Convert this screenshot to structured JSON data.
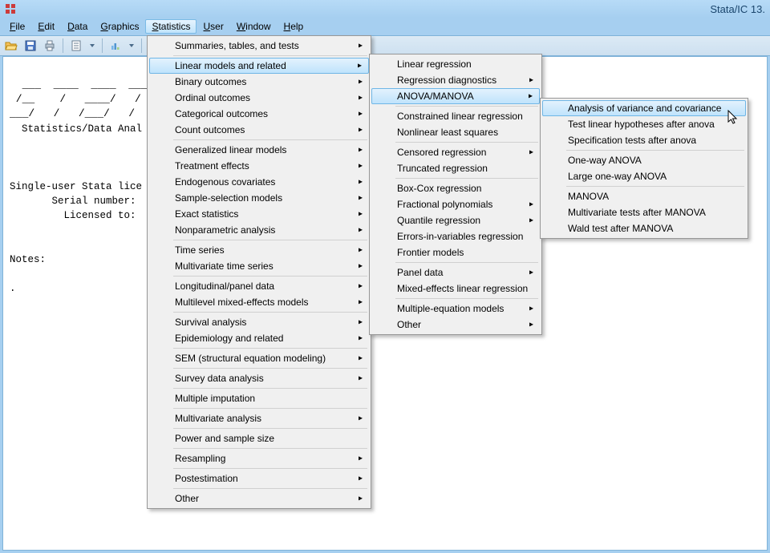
{
  "window": {
    "title": "Stata/IC 13."
  },
  "menubar": {
    "file": "File",
    "edit": "Edit",
    "data": "Data",
    "graphics": "Graphics",
    "statistics": "Statistics",
    "user": "User",
    "window": "Window",
    "help": "Help"
  },
  "ascii": {
    "l1": "  ___  ____  ____  ___",
    "l2": " /__    /   ____/   / ",
    "l3": "___/   /   /___/   / ",
    "l4": "  Statistics/Data Anal"
  },
  "content": {
    "license1": "Single-user Stata lice",
    "license2": "       Serial number:",
    "license3": "         Licensed to:",
    "notes": "Notes:",
    "dot": "."
  },
  "stats_menu": {
    "summaries": "Summaries, tables, and tests",
    "linear": "Linear models and related",
    "binary": "Binary outcomes",
    "ordinal": "Ordinal outcomes",
    "categorical": "Categorical outcomes",
    "count": "Count outcomes",
    "glm": "Generalized linear models",
    "treatment": "Treatment effects",
    "endog": "Endogenous covariates",
    "sample": "Sample-selection models",
    "exact": "Exact statistics",
    "nonparam": "Nonparametric analysis",
    "ts": "Time series",
    "mts": "Multivariate time series",
    "longitudinal": "Longitudinal/panel data",
    "multilevel": "Multilevel mixed-effects models",
    "survival": "Survival analysis",
    "epi": "Epidemiology and related",
    "sem": "SEM (structural equation modeling)",
    "survey": "Survey data analysis",
    "mi": "Multiple imputation",
    "mv": "Multivariate analysis",
    "power": "Power and sample size",
    "resampling": "Resampling",
    "postest": "Postestimation",
    "other": "Other"
  },
  "linear_menu": {
    "linreg": "Linear regression",
    "regdiag": "Regression diagnostics",
    "anova": "ANOVA/MANOVA",
    "cnsreg": "Constrained linear regression",
    "nl": "Nonlinear least squares",
    "censored": "Censored regression",
    "truncated": "Truncated regression",
    "boxcox": "Box-Cox regression",
    "fracpoly": "Fractional polynomials",
    "qreg": "Quantile regression",
    "eivreg": "Errors-in-variables regression",
    "frontier": "Frontier models",
    "panel": "Panel data",
    "mixed": "Mixed-effects linear regression",
    "meqn": "Multiple-equation models",
    "other": "Other"
  },
  "anova_menu": {
    "aov": "Analysis of variance and covariance",
    "testlinear": "Test linear hypotheses after anova",
    "spectests": "Specification tests after anova",
    "oneway": "One-way ANOVA",
    "loneway": "Large one-way ANOVA",
    "manova": "MANOVA",
    "mvtests": "Multivariate tests after MANOVA",
    "wald": "Wald test after MANOVA"
  }
}
